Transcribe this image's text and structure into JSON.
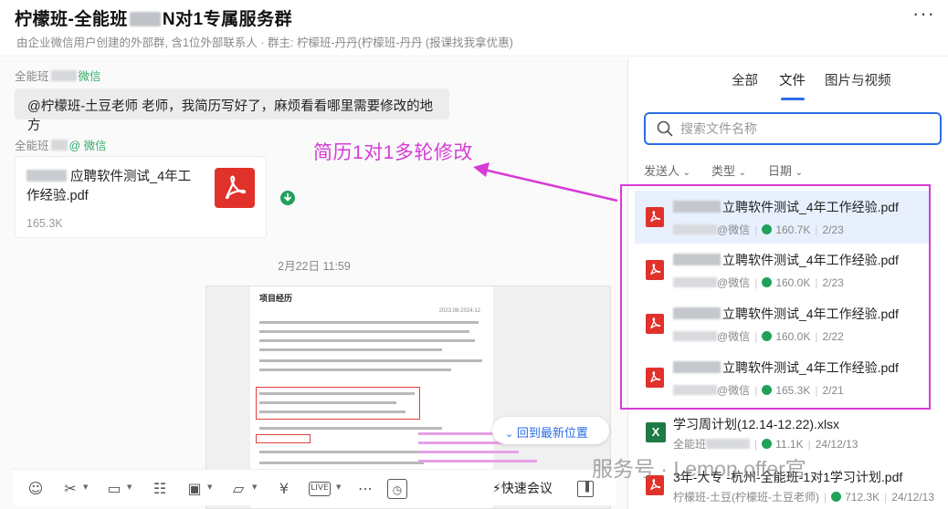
{
  "header": {
    "title_prefix": "柠檬班-全能班",
    "title_suffix": "N对1专属服务群",
    "subtitle": "由企业微信用户创建的外部群, 含1位外部联系人 · 群主: 柠檬班-丹丹(柠檬班-丹丹 (报课找我拿优惠)",
    "more_label": "···"
  },
  "chat": {
    "msg1": {
      "sender_prefix": "全能班",
      "sender_suffix": "微信",
      "text": "@柠檬班-土豆老师 老师，我简历写好了，麻烦看看哪里需要修改的地方"
    },
    "msg2": {
      "sender_prefix": "全能班",
      "sender_suffix": "@ 微信",
      "file_name": "应聘软件测试_4年工作经验.pdf",
      "file_size": "165.3K"
    },
    "timestamp": "2月22日 11:59",
    "annotation": "简历1对1多轮修改",
    "preview": {
      "heading": "项目经历",
      "date": "2023.08-2024.12"
    },
    "back_to_latest": "回到最新位置"
  },
  "toolbar": {
    "icons": [
      "smile-icon",
      "scissors-icon",
      "image-icon",
      "doc-icon",
      "calendar-check-icon",
      "folder-icon",
      "yen-icon",
      "live-icon",
      "more-circle-icon",
      "clock-screen-icon"
    ],
    "quick_meeting": "快速会议"
  },
  "panel": {
    "tabs": [
      "全部",
      "文件",
      "图片与视频"
    ],
    "active_tab": "文件",
    "search_placeholder": "搜索文件名称",
    "filters": [
      "发送人",
      "类型",
      "日期"
    ],
    "files": [
      {
        "name": "立聘软件测试_4年工作经验.pdf",
        "sender_suffix": "@微信",
        "size": "160.7K",
        "date": "2/23",
        "type": "pdf"
      },
      {
        "name": "立聘软件测试_4年工作经验.pdf",
        "sender_suffix": "@微信",
        "size": "160.0K",
        "date": "2/23",
        "type": "pdf"
      },
      {
        "name": "立聘软件测试_4年工作经验.pdf",
        "sender_suffix": "@微信",
        "size": "160.0K",
        "date": "2/22",
        "type": "pdf"
      },
      {
        "name": "立聘软件测试_4年工作经验.pdf",
        "sender_suffix": "@微信",
        "size": "165.3K",
        "date": "2/21",
        "type": "pdf"
      },
      {
        "name": "学习周计划(12.14-12.22).xlsx",
        "sender_prefix": "全能班",
        "size": "11.1K",
        "date": "24/12/13",
        "type": "xlsx"
      },
      {
        "name": "3年-大专        -杭州-全能班-1对1学习计划.pdf",
        "sender_prefix": "柠檬班-土豆(柠檬班-土豆老师)",
        "size": "712.3K",
        "date": "24/12/13",
        "type": "pdf"
      }
    ]
  },
  "watermark": "服务号 · Lemon offer官",
  "colors": {
    "accent": "#2b6de6",
    "annotation": "#d63bd6",
    "pdf": "#e0322b",
    "download": "#20a15a"
  }
}
